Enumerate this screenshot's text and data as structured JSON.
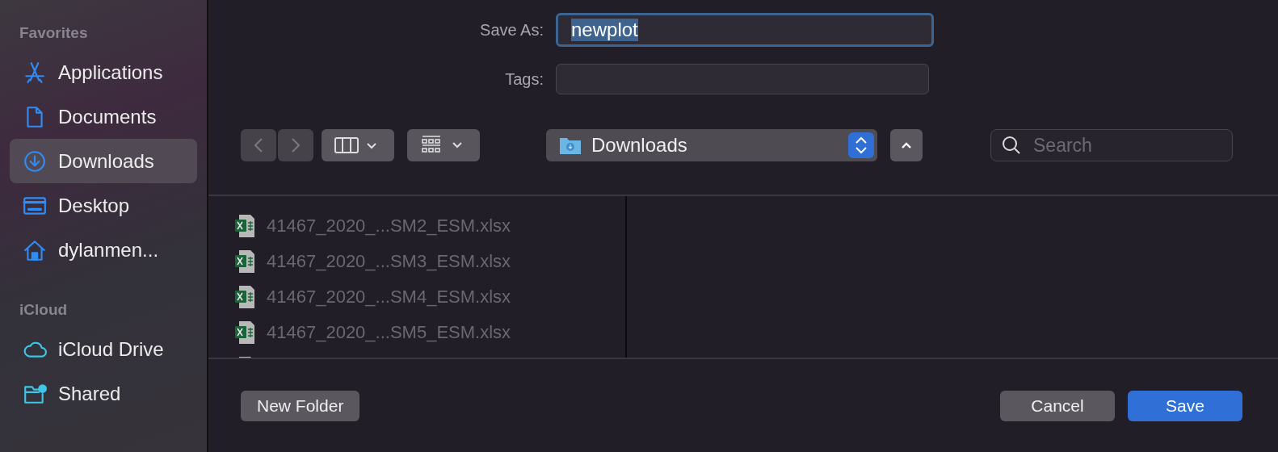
{
  "sidebar": {
    "sections": [
      {
        "heading": "Favorites",
        "items": [
          {
            "label": "Applications",
            "kind": "apps",
            "selected": false
          },
          {
            "label": "Documents",
            "kind": "document",
            "selected": false
          },
          {
            "label": "Downloads",
            "kind": "download",
            "selected": true
          },
          {
            "label": "Desktop",
            "kind": "desktop",
            "selected": false
          },
          {
            "label": "dylanmen...",
            "kind": "home",
            "selected": false
          }
        ]
      },
      {
        "heading": "iCloud",
        "items": [
          {
            "label": "iCloud Drive",
            "kind": "cloud",
            "selected": false
          },
          {
            "label": "Shared",
            "kind": "shared",
            "selected": false
          }
        ]
      }
    ]
  },
  "save_as": {
    "label": "Save As:",
    "value": "newplot",
    "text_selected": true
  },
  "tags": {
    "label": "Tags:"
  },
  "toolbar": {
    "back_disabled": true,
    "forward_disabled": true,
    "location": "Downloads",
    "search_placeholder": "Search"
  },
  "files": [
    {
      "name": "41467_2020_...SM2_ESM.xlsx",
      "disabled": true
    },
    {
      "name": "41467_2020_...SM3_ESM.xlsx",
      "disabled": true
    },
    {
      "name": "41467_2020_...SM4_ESM.xlsx",
      "disabled": true
    },
    {
      "name": "41467_2020_...SM5_ESM.xlsx",
      "disabled": true
    }
  ],
  "buttons": [
    {
      "label": "New Folder",
      "kind": "left"
    },
    {
      "label": "Cancel",
      "kind": "normal"
    },
    {
      "label": "Save",
      "kind": "default"
    }
  ]
}
